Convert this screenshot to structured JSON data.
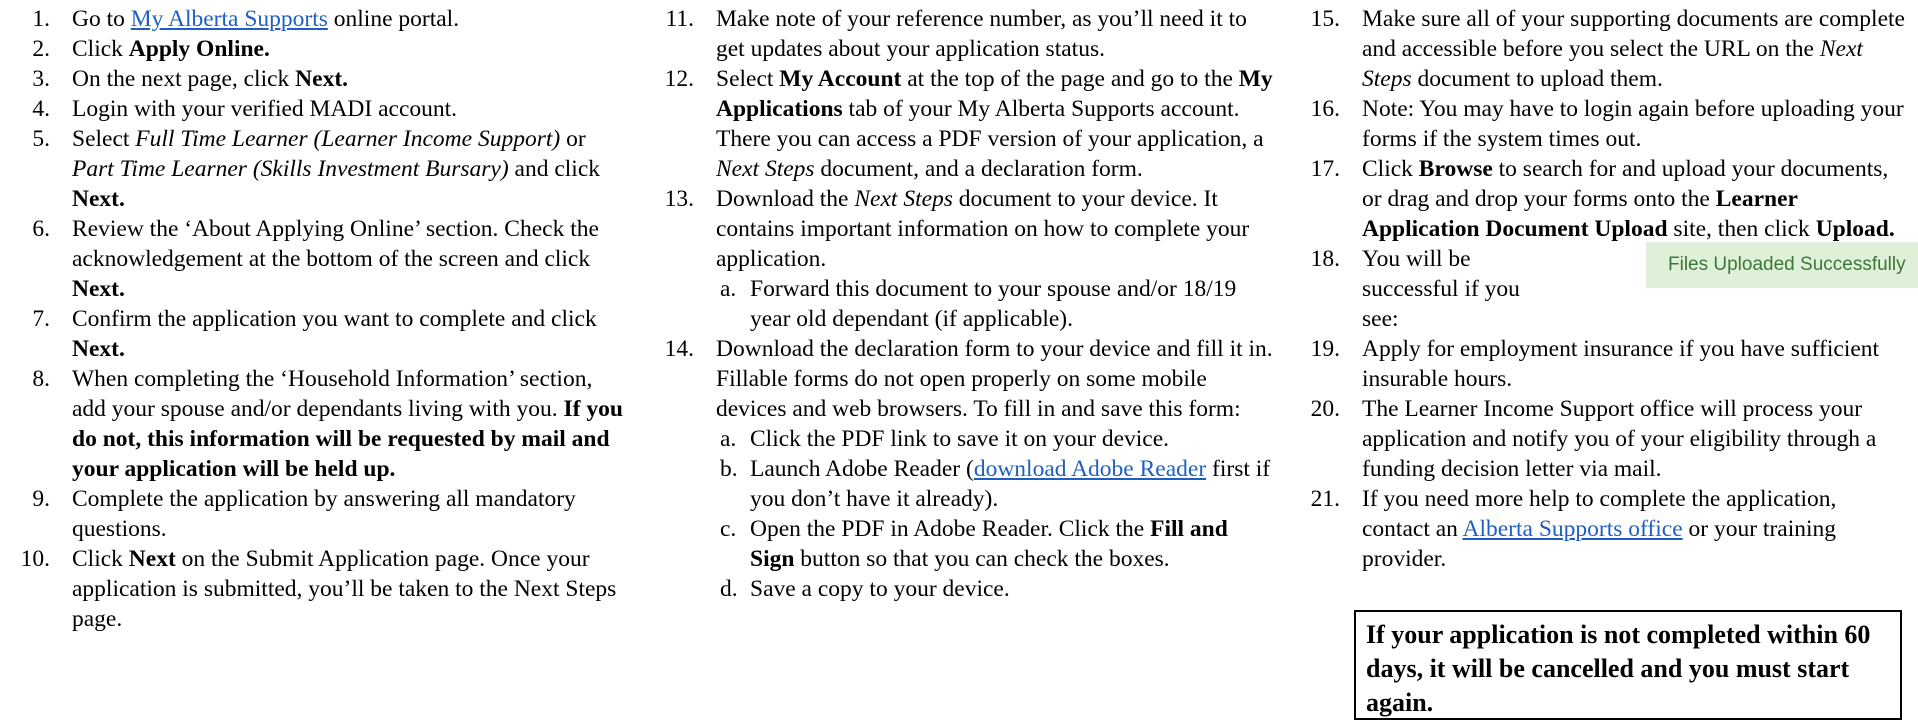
{
  "col1": {
    "i1": {
      "n": "1.",
      "a": "Go to ",
      "link": "My Alberta Supports",
      "b": " online portal."
    },
    "i2": {
      "n": "2.",
      "a": "Click ",
      "bold": "Apply Online."
    },
    "i3": {
      "n": "3.",
      "a": "On the next page, click ",
      "bold": "Next."
    },
    "i4": {
      "n": "4.",
      "a": "Login with your verified MADI account."
    },
    "i5": {
      "n": "5.",
      "a": "Select ",
      "it1": "Full Time Learner (Learner Income Support)",
      "b": " or ",
      "it2": "Part Time Learner (Skills Investment Bursary)",
      "c": " and click ",
      "bold": "Next."
    },
    "i6": {
      "n": "6.",
      "a": "Review the ‘About Applying Online’ section. Check the acknowledgement at the bottom of the screen and click ",
      "bold": "Next."
    },
    "i7": {
      "n": "7.",
      "a": "Confirm the application you want to complete and click ",
      "bold": "Next."
    },
    "i8": {
      "n": "8.",
      "a": "When completing the ‘Household Information’ section, add your spouse and/or dependants living with you. ",
      "bold": "If you do not, this information will be requested by mail and your application will be held up."
    },
    "i9": {
      "n": "9.",
      "a": "Complete the application by answering all mandatory questions."
    },
    "i10": {
      "n": "10.",
      "a": "Click ",
      "bold": "Next",
      "b": " on the Submit Application page. Once your application is submitted, you’ll be taken to the Next Steps page."
    }
  },
  "col2": {
    "i11": {
      "n": "11.",
      "a": "Make note of your reference number, as you’ll need it to get updates about your application status."
    },
    "i12": {
      "n": "12.",
      "a": "Select ",
      "bold1": "My Account",
      "b": " at the top of the page and go to the ",
      "bold2": "My Applications",
      "c": " tab of your My Alberta Supports account. There you can access a PDF version of your application, a ",
      "it": "Next Steps",
      "d": " document, and a declaration form."
    },
    "i13": {
      "n": "13.",
      "a": "Download the ",
      "it": "Next Steps",
      "b": " document to your device. It contains important information on how to complete your application.",
      "sa": {
        "n": "a.",
        "t": "Forward this document to your spouse and/or 18/19 year old dependant (if applicable)."
      }
    },
    "i14": {
      "n": "14.",
      "a": "Download the declaration form to your device and fill it in. Fillable forms do not open properly on some mobile devices and web browsers. To fill in and save this form:",
      "sa": {
        "n": "a.",
        "t": "Click the PDF link to save it on your device."
      },
      "sb": {
        "n": "b.",
        "a": "Launch Adobe Reader (",
        "link": "download Adobe Reader",
        "b": " first if you don’t have it already)."
      },
      "sc": {
        "n": "c.",
        "a": "Open the PDF in Adobe Reader. Click the ",
        "bold": "Fill and Sign",
        "b": " button so that you can check the boxes."
      },
      "sd": {
        "n": "d.",
        "t": "Save a copy to your device."
      }
    }
  },
  "col3": {
    "i15": {
      "n": "15.",
      "a": "Make sure all of your supporting documents are complete and accessible before you select the URL on the ",
      "it": "Next Steps",
      "b": " document to upload them."
    },
    "i16": {
      "n": "16.",
      "a": "Note: You may have to login again before uploading your forms if the system times out."
    },
    "i17": {
      "n": "17.",
      "a": "Click ",
      "bold1": "Browse",
      "b": " to search for and upload your documents, or drag and drop your forms onto the ",
      "bold2": "Learner Application Document Upload",
      "c": " site, then click ",
      "bold3": "Upload."
    },
    "i18": {
      "n": "18.",
      "a": "You will be successful if you see:",
      "badge": "Files Uploaded Successfully"
    },
    "i19": {
      "n": "19.",
      "a": "Apply for employment insurance if you have sufficient insurable hours."
    },
    "i20": {
      "n": "20.",
      "a": "The Learner Income Support office will process your application and notify you of your eligibility through a funding decision letter via mail."
    },
    "i21": {
      "n": "21.",
      "a": "If you need more help to complete the application, contact an ",
      "link": "Alberta Supports office",
      "b": " or your training provider."
    }
  },
  "notice": "If your application is not completed within 60 days, it will be cancelled and you must start again.",
  "colors": {
    "link": "#1f5fc2",
    "badge_bg": "#dff0d8",
    "badge_text": "#3c763d"
  }
}
